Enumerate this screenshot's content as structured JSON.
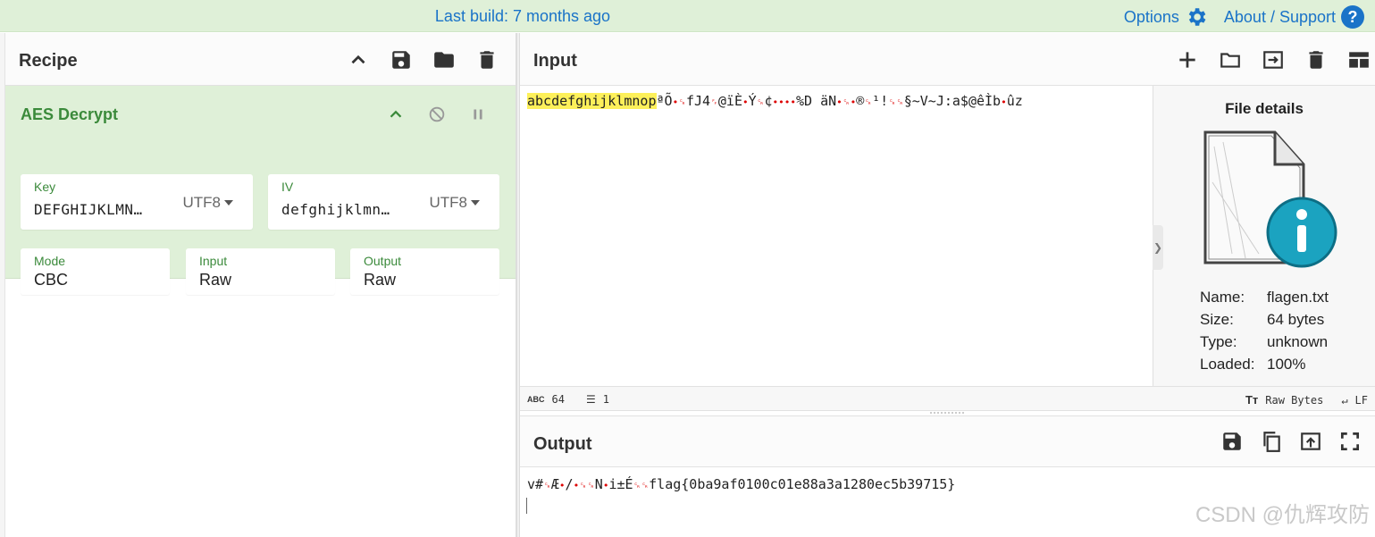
{
  "banner": {
    "build": "Last build: 7 months ago",
    "options": "Options",
    "about": "About / Support",
    "help_glyph": "?"
  },
  "recipe": {
    "title": "Recipe",
    "operation": {
      "name": "AES Decrypt",
      "key": {
        "label": "Key",
        "value": "DEFGHIJKLMN…",
        "encoding": "UTF8"
      },
      "iv": {
        "label": "IV",
        "value": "defghijklmn…",
        "encoding": "UTF8"
      },
      "mode": {
        "label": "Mode",
        "value": "CBC"
      },
      "input": {
        "label": "Input",
        "value": "Raw"
      },
      "output": {
        "label": "Output",
        "value": "Raw"
      }
    }
  },
  "input": {
    "title": "Input",
    "highlighted": "abcdefghijklmnop",
    "rest_1": "ªÕ",
    "rest_2": "fJ4",
    "rest_3": "@ïÈ",
    "rest_4": "Ý",
    "rest_5": "¢",
    "rest_6": "%D äN",
    "rest_7": "®",
    "rest_8": "¹!",
    "rest_9": "§~V~J:a$@êÌb",
    "rest_10": "ûz",
    "status": {
      "chars": "64",
      "lines": "1",
      "format": "Raw Bytes",
      "eol": "LF"
    }
  },
  "file_details": {
    "title": "File details",
    "name_label": "Name:",
    "name": "flagen.txt",
    "size_label": "Size:",
    "size": "64 bytes",
    "type_label": "Type:",
    "type": "unknown",
    "loaded_label": "Loaded:",
    "loaded": "100%"
  },
  "output": {
    "title": "Output",
    "text_1": "v#",
    "text_2": "Æ",
    "text_3": "/",
    "text_4": "N",
    "text_5": "i±É",
    "text_6": "flag{0ba9af0100c01e88a3a1280ec5b39715}"
  },
  "watermark": "CSDN @仇辉攻防",
  "colors": {
    "banner_bg": "#dff0d8",
    "link": "#1a73c8",
    "op_green": "#3b8a3b",
    "highlight": "#fdf05a",
    "control_char": "#dd0000"
  }
}
